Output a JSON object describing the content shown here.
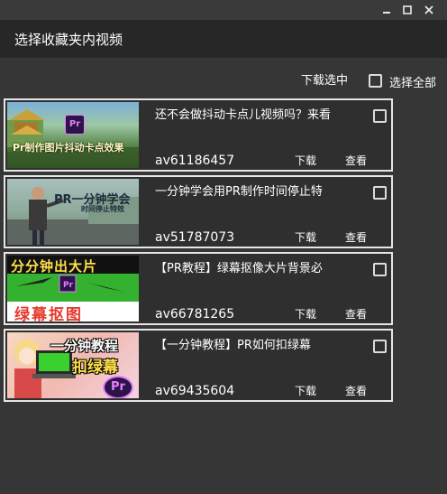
{
  "window": {
    "title": "选择收藏夹内视频",
    "controls": {
      "minimize": "–",
      "maximize": "□",
      "close": "✕"
    }
  },
  "toolbar": {
    "download_selected": "下载选中",
    "select_all": "选择全部"
  },
  "videos": [
    {
      "title": "还不会做抖动卡点儿视频吗？来看",
      "id": "av61186457",
      "download": "下载",
      "view": "查看",
      "thumb": {
        "text": "Pr制作图片抖动卡点效果",
        "sub": "Pr",
        "bg": "#5d8c4a"
      }
    },
    {
      "title": "一分钟学会用PR制作时间停止特",
      "id": "av51787073",
      "download": "下载",
      "view": "查看",
      "thumb": {
        "text": "PR一分钟学会",
        "sub": "时间停止特效",
        "bg": "#8fa7a0"
      }
    },
    {
      "title": "【PR教程】绿幕抠像大片背景必",
      "id": "av66781265",
      "download": "下载",
      "view": "查看",
      "thumb": {
        "text": "分分钟出大片",
        "sub": "绿幕抠图",
        "bg": "#34b22f"
      }
    },
    {
      "title": "【一分钟教程】PR如何扣绿幕",
      "id": "av69435604",
      "download": "下载",
      "view": "查看",
      "thumb": {
        "text": "一分钟教程",
        "sub": "扣绿幕",
        "bg": "#f2c9a8"
      }
    }
  ],
  "colors": {
    "window_bg": "#363636",
    "header_bg": "#272727",
    "card_border": "#e6e6e6",
    "pr_purple": "#2b1548",
    "pr_accent": "#e77cff"
  }
}
